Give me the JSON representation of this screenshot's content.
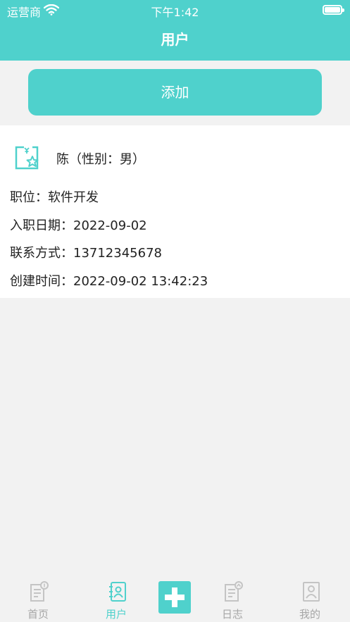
{
  "status_bar": {
    "carrier": "运营商",
    "time": "下午1:42"
  },
  "nav": {
    "title": "用户"
  },
  "add_button": {
    "label": "添加"
  },
  "user": {
    "header": "陈（性别：男）",
    "position": "职位：软件开发",
    "hire_date": "入职日期：2022-09-02",
    "contact": "联系方式：13712345678",
    "created": "创建时间：2022-09-02 13:42:23"
  },
  "tabs": [
    {
      "label": "首页",
      "icon": "home-doc-icon"
    },
    {
      "label": "用户",
      "icon": "user-book-icon",
      "active": true
    },
    {
      "label": "",
      "icon": "plus-icon"
    },
    {
      "label": "日志",
      "icon": "log-doc-icon"
    },
    {
      "label": "我的",
      "icon": "profile-icon"
    }
  ],
  "colors": {
    "accent": "#4fd1cc",
    "background": "#f2f2f2",
    "inactive": "#a6a6a6"
  }
}
